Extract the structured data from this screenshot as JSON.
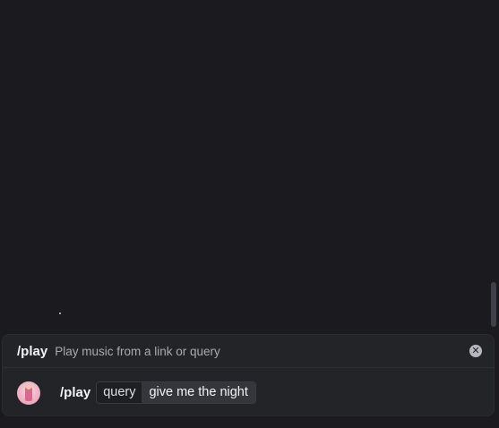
{
  "command": {
    "name": "/play",
    "description": "Play music from a link or query"
  },
  "input": {
    "command": "/play",
    "option_name": "query",
    "option_value": "give me the night"
  },
  "icons": {
    "close": "close-circle-icon",
    "avatar": "user-avatar"
  },
  "colors": {
    "background": "#1b1b1f",
    "panel": "#232428",
    "text": "#f2f3f5",
    "muted": "#a9abb3"
  }
}
